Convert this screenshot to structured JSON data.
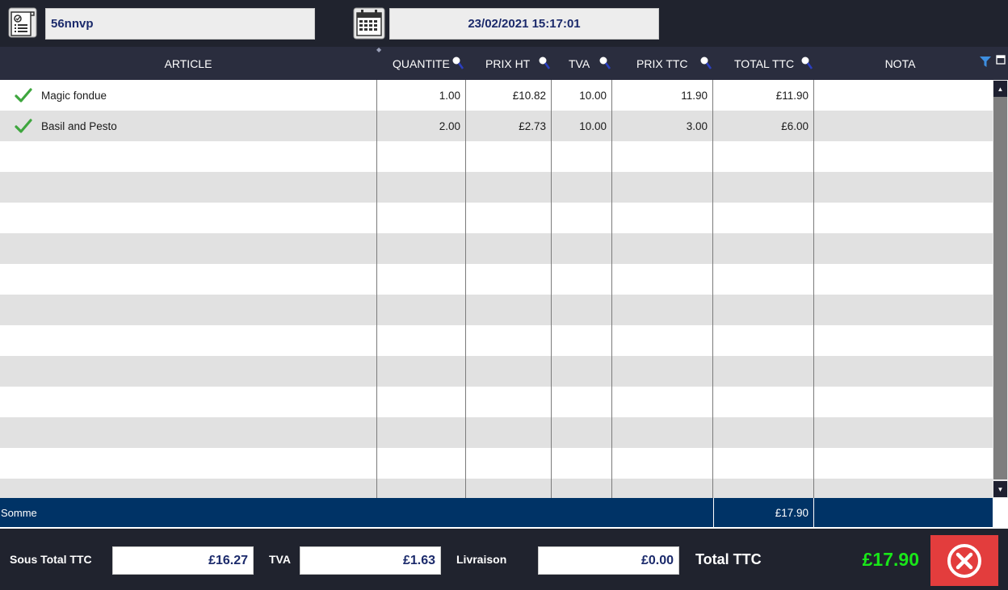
{
  "ticket": {
    "number": "56nnvp",
    "icon": "ticket-icon"
  },
  "datetime": {
    "value": "23/02/2021 15:17:01",
    "icon": "calendar-icon"
  },
  "columns": {
    "article": "ARTICLE",
    "quantite": "QUANTITE",
    "prix_ht": "PRIX HT",
    "tva": "TVA",
    "prix_ttc": "PRIX TTC",
    "total_ttc": "TOTAL TTC",
    "nota": "NOTA"
  },
  "rows": [
    {
      "status_icon": "check-icon",
      "article": "Magic fondue",
      "quantite": "1.00",
      "prix_ht": "£10.82",
      "tva": "10.00",
      "prix_ttc": "11.90",
      "total_ttc": "£11.90",
      "nota": ""
    },
    {
      "status_icon": "check-icon",
      "article": "Basil and Pesto",
      "quantite": "2.00",
      "prix_ht": "£2.73",
      "tva": "10.00",
      "prix_ttc": "3.00",
      "total_ttc": "£6.00",
      "nota": ""
    }
  ],
  "sum": {
    "label": "Somme",
    "total_ttc": "£17.90"
  },
  "footer": {
    "sous_total_label": "Sous Total TTC",
    "sous_total_value": "£16.27",
    "tva_label": "TVA",
    "tva_value": "£1.63",
    "livraison_label": "Livraison",
    "livraison_value": "£0.00",
    "total_label": "Total TTC",
    "total_value": "£17.90"
  },
  "colors": {
    "topbar": "#20232e",
    "header": "#2a2d3e",
    "sum_row": "#003366",
    "total_green": "#19e619",
    "close_red": "#e33d3d",
    "field_text": "#1b2a6b"
  }
}
